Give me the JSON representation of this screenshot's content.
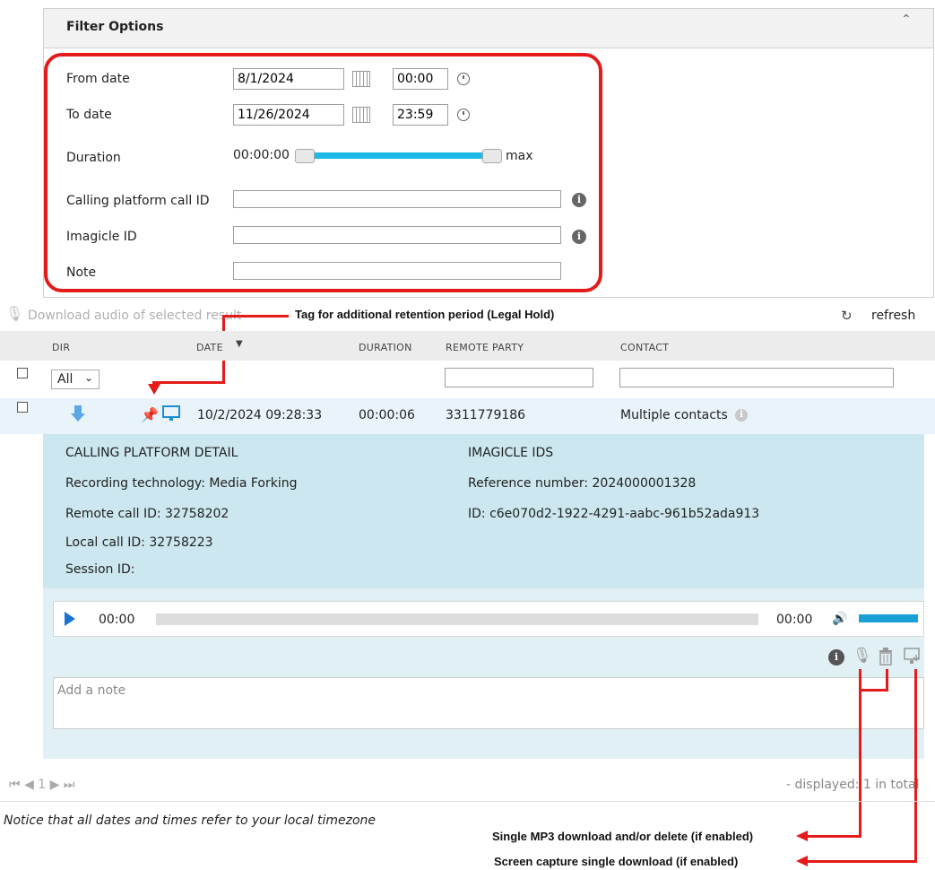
{
  "filter": {
    "title": "Filter Options",
    "from_date_label": "From date",
    "from_date": "8/1/2024",
    "from_time": "00:00",
    "to_date_label": "To date",
    "to_date": "11/26/2024",
    "to_time": "23:59",
    "duration_label": "Duration",
    "duration_min": "00:00:00",
    "duration_max": "max",
    "calling_id_label": "Calling platform call ID",
    "imagicle_id_label": "Imagicle ID",
    "note_label": "Note"
  },
  "toolbar": {
    "download_label": "Download audio of selected result",
    "refresh_label": "refresh"
  },
  "table": {
    "headers": [
      "DIR",
      "DATE",
      "DURATION",
      "REMOTE PARTY",
      "CONTACT"
    ],
    "dir_filter": "All",
    "row": {
      "date": "10/2/2024 09:28:33",
      "duration": "00:00:06",
      "remote_party": "3311779186",
      "contact": "Multiple contacts"
    }
  },
  "detail": {
    "left_title": "CALLING PLATFORM DETAIL",
    "recording_tech": "Recording technology: Media Forking",
    "remote_call_id": "Remote call ID: 32758202",
    "local_call_id": "Local call ID: 32758223",
    "session_id": "Session ID:",
    "right_title": "IMAGICLE IDS",
    "reference_number": "Reference number: 2024000001328",
    "id": "ID: c6e070d2-1922-4291-aabc-961b52ada913"
  },
  "player": {
    "current_time": "00:00",
    "total_time": "00:00"
  },
  "note_placeholder": "Add a note",
  "pager": {
    "page": "1",
    "displayed": "- displayed: 1 in total"
  },
  "notice": "Notice that all dates and times refer to your local timezone",
  "annotations": {
    "legal_hold": "Tag for additional  retention period (Legal Hold)",
    "mp3": "Single MP3 download and/or delete (if enabled)",
    "screen": "Screen capture single download (if enabled)"
  },
  "colors": {
    "accent": "#1cb8e6",
    "annotation_red": "#e41b1b",
    "detail_bg": "#cce7ef"
  }
}
